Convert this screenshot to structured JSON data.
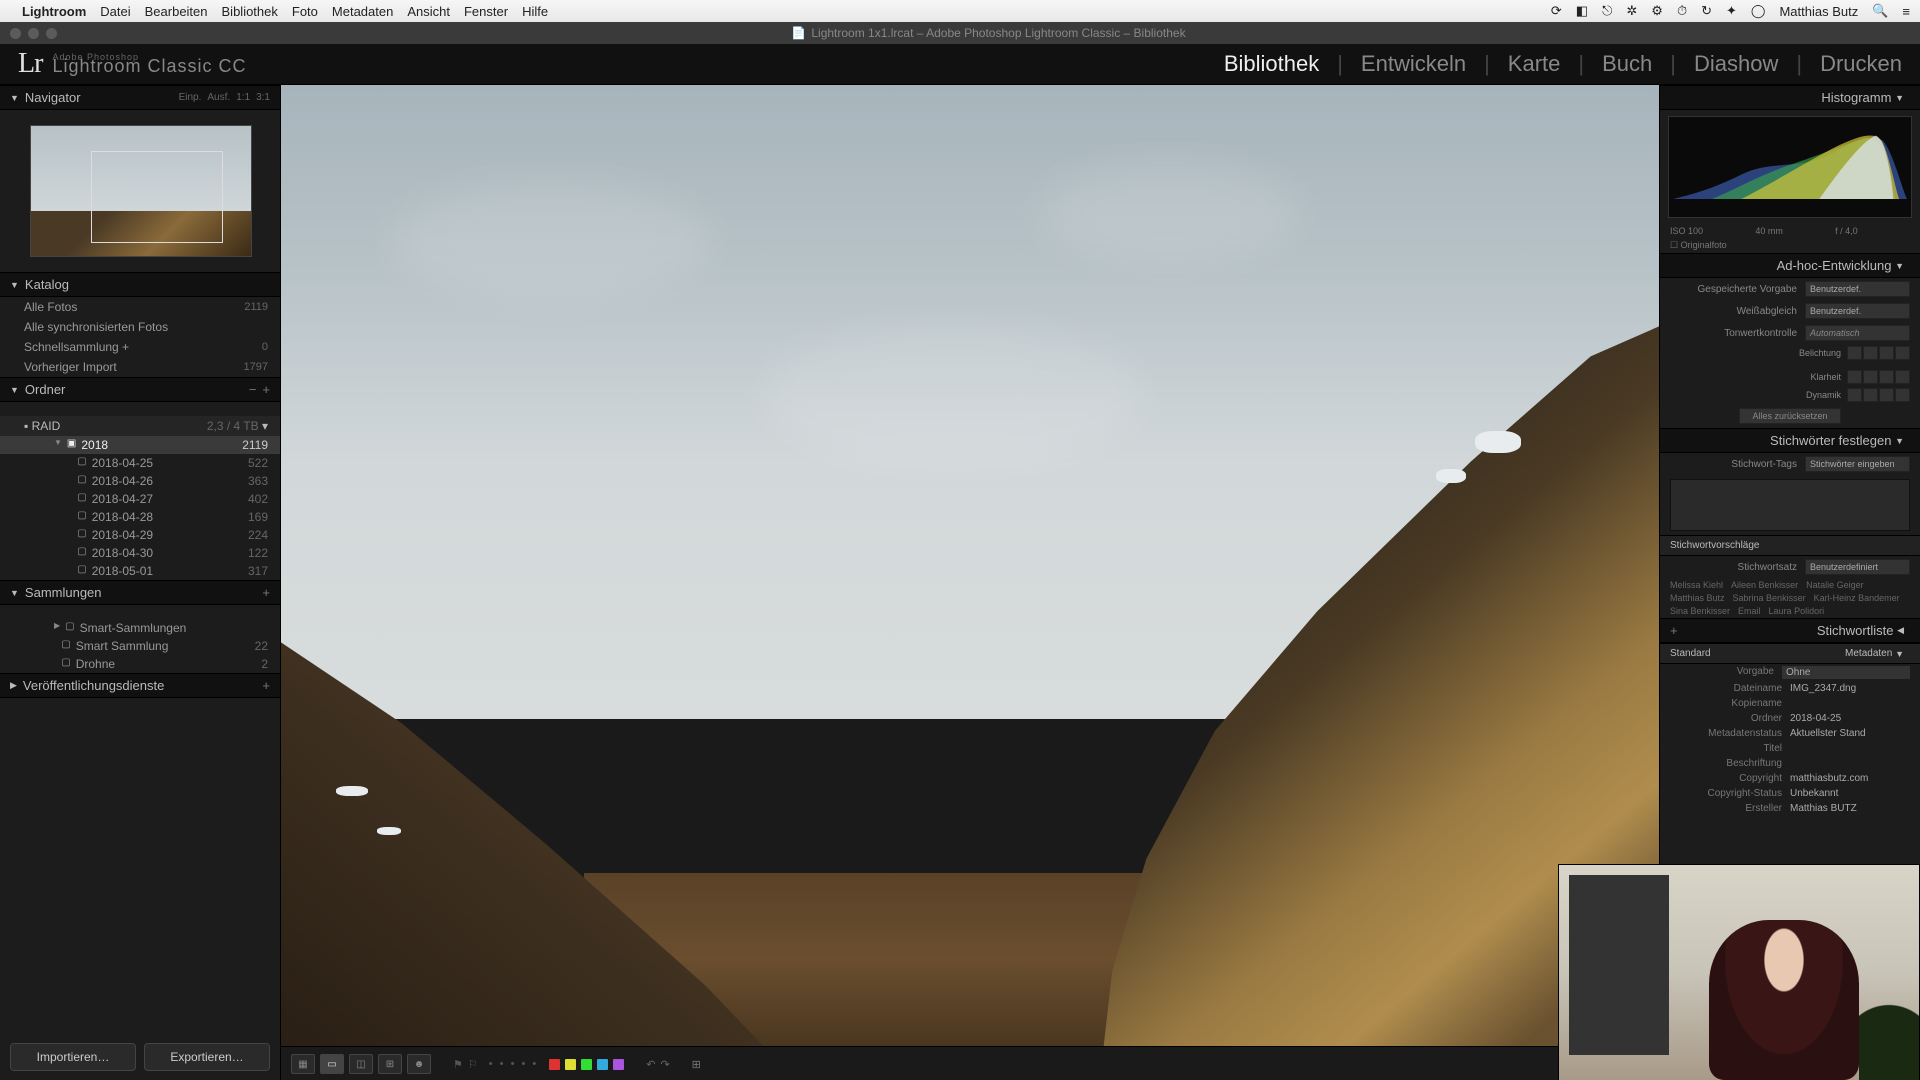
{
  "mac_menu": {
    "app": "Lightroom",
    "items": [
      "Datei",
      "Bearbeiten",
      "Bibliothek",
      "Foto",
      "Metadaten",
      "Ansicht",
      "Fenster",
      "Hilfe"
    ],
    "user": "Matthias Butz"
  },
  "window_title": "Lightroom 1x1.lrcat – Adobe Photoshop Lightroom Classic – Bibliothek",
  "identity": {
    "tag": "Adobe Photoshop",
    "product": "Lightroom Classic CC"
  },
  "modules": [
    "Bibliothek",
    "Entwickeln",
    "Karte",
    "Buch",
    "Diashow",
    "Drucken"
  ],
  "active_module": "Bibliothek",
  "navigator": {
    "title": "Navigator",
    "zoom": [
      "Einp.",
      "Ausf.",
      "1:1",
      "3:1"
    ]
  },
  "catalog": {
    "title": "Katalog",
    "items": [
      {
        "label": "Alle Fotos",
        "count": "2119"
      },
      {
        "label": "Alle synchronisierten Fotos",
        "count": ""
      },
      {
        "label": "Schnellsammlung  +",
        "count": "0"
      },
      {
        "label": "Vorheriger Import",
        "count": "1797"
      }
    ]
  },
  "folders": {
    "title": "Ordner",
    "drive": {
      "name": "RAID",
      "stat": "2,3 / 4 TB"
    },
    "year": {
      "name": "2018",
      "count": "2119"
    },
    "dates": [
      {
        "name": "2018-04-25",
        "count": "522"
      },
      {
        "name": "2018-04-26",
        "count": "363"
      },
      {
        "name": "2018-04-27",
        "count": "402"
      },
      {
        "name": "2018-04-28",
        "count": "169"
      },
      {
        "name": "2018-04-29",
        "count": "224"
      },
      {
        "name": "2018-04-30",
        "count": "122"
      },
      {
        "name": "2018-05-01",
        "count": "317"
      }
    ],
    "selected": 0
  },
  "collections": {
    "title": "Sammlungen",
    "items": [
      {
        "label": "Smart-Sammlungen",
        "count": ""
      },
      {
        "label": "Smart Sammlung",
        "count": "22"
      },
      {
        "label": "Drohne",
        "count": "2"
      }
    ]
  },
  "publish": {
    "title": "Veröffentlichungsdienste"
  },
  "buttons": {
    "import": "Importieren…",
    "export": "Exportieren…"
  },
  "histogram": {
    "title": "Histogramm",
    "iso": "ISO 100",
    "focal": "40 mm",
    "aperture": "f / 4,0",
    "ev": "",
    "original": "Originalfoto"
  },
  "quickdev": {
    "title": "Ad-hoc-Entwicklung",
    "preset": {
      "lbl": "Gespeicherte Vorgabe",
      "val": "Benutzerdef."
    },
    "wb": {
      "lbl": "Weißabgleich",
      "val": "Benutzerdef."
    },
    "tone": {
      "lbl": "Tonwertkontrolle",
      "val": "Automatisch"
    },
    "exposure": "Belichtung",
    "clarity": "Klarheit",
    "vibrance": "Dynamik",
    "reset": "Alles zurücksetzen"
  },
  "keywording": {
    "title": "Stichwörter festlegen",
    "tags_lbl": "Stichwort-Tags",
    "tags_ph": "Stichwörter eingeben",
    "sugg_title": "Stichwortvorschläge",
    "set_lbl": "Stichwortsatz",
    "set_val": "Benutzerdefiniert",
    "suggestions": [
      "Melissa Kiehl",
      "Aileen Benkisser",
      "Natalie Geiger",
      "Matthias Butz",
      "Sabrina Benkisser",
      "Karl-Heinz Bandemer",
      "Sina Benkisser",
      "Email",
      "Laura Polidori"
    ]
  },
  "keywordlist": {
    "title": "Stichwortliste"
  },
  "metadata": {
    "title": "Metadaten",
    "preset": {
      "lbl": "Standard",
      "drop": ""
    },
    "template": {
      "lbl": "Vorgabe",
      "val": "Ohne"
    },
    "rows": [
      {
        "k": "Dateiname",
        "v": "IMG_2347.dng"
      },
      {
        "k": "Kopiename",
        "v": ""
      },
      {
        "k": "Ordner",
        "v": "2018-04-25"
      },
      {
        "k": "Metadatenstatus",
        "v": "Aktuellster Stand"
      },
      {
        "k": "Titel",
        "v": ""
      },
      {
        "k": "Beschriftung",
        "v": ""
      },
      {
        "k": "Copyright",
        "v": "matthiasbutz.com"
      },
      {
        "k": "Copyright-Status",
        "v": "Unbekannt"
      },
      {
        "k": "Ersteller",
        "v": "Matthias BUTZ"
      }
    ]
  },
  "colors": {
    "chips": [
      "#d33",
      "#dd3",
      "#3d3",
      "#3ad",
      "#a5d"
    ]
  }
}
